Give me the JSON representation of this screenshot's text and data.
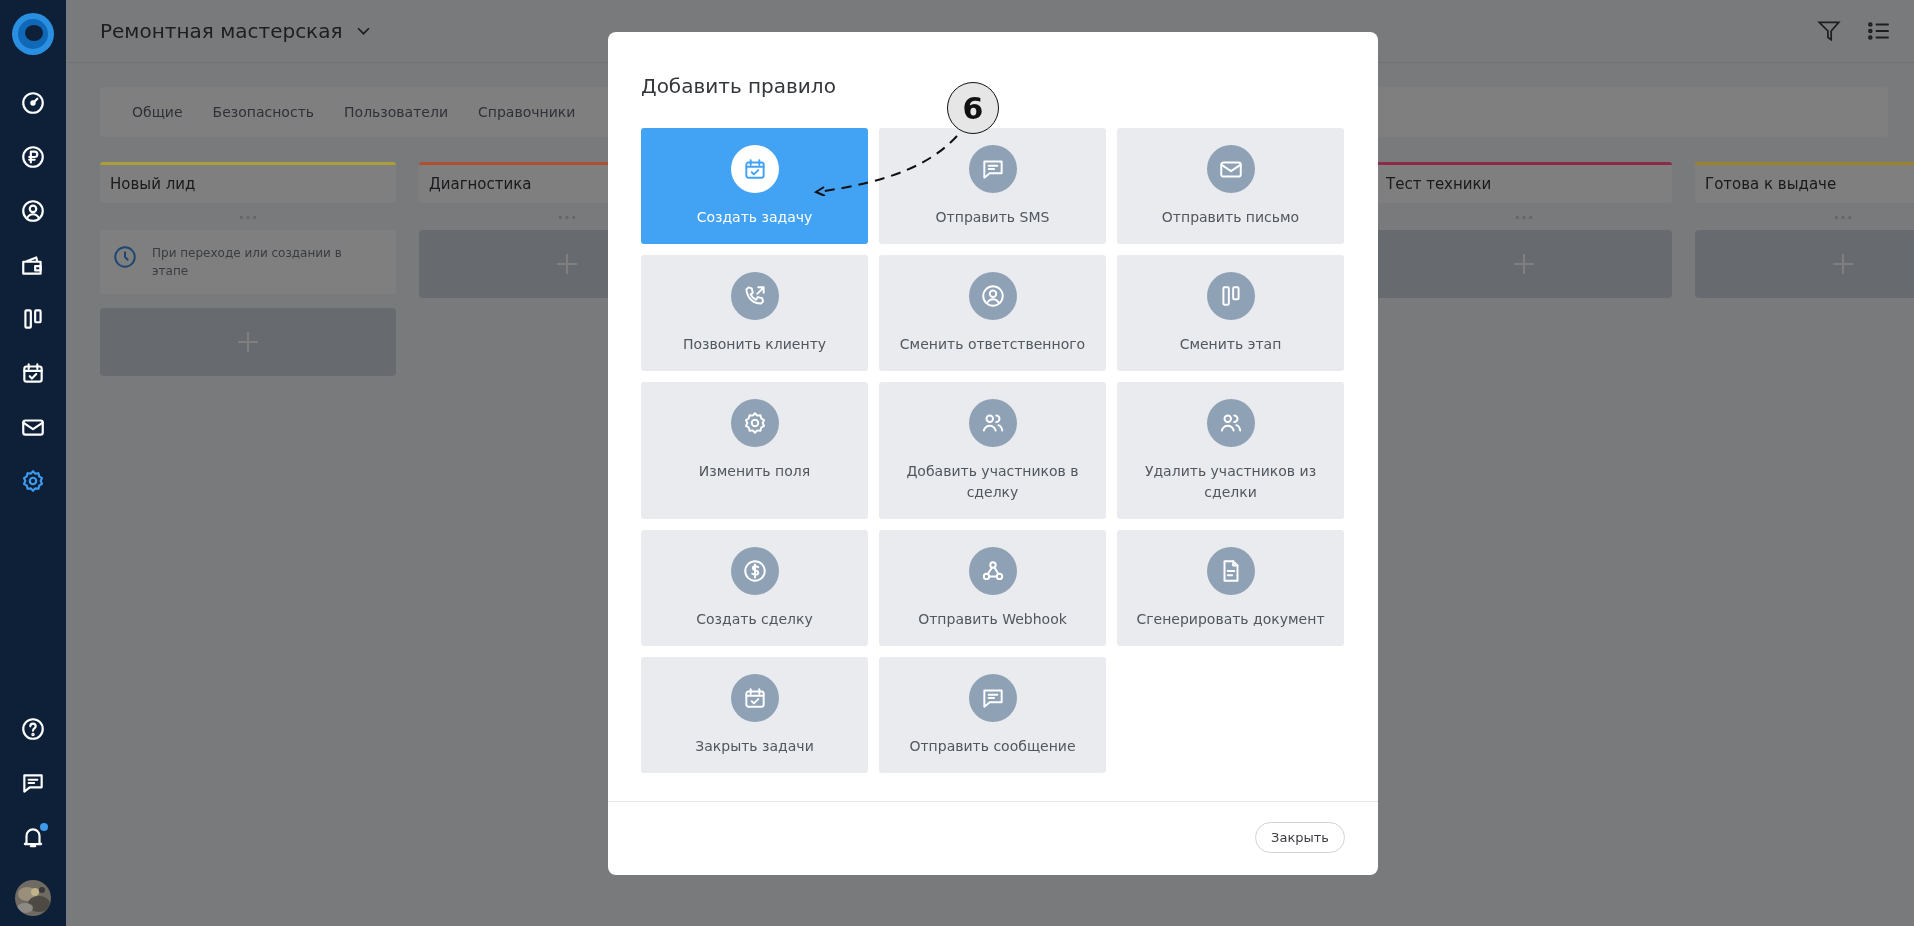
{
  "sidebar": {
    "top": [
      {
        "kind": "gauge",
        "selected": false
      },
      {
        "kind": "ruble",
        "selected": false
      },
      {
        "kind": "user",
        "selected": false
      },
      {
        "kind": "wallet",
        "selected": false
      },
      {
        "kind": "columns",
        "selected": false
      },
      {
        "kind": "calendar",
        "selected": false
      },
      {
        "kind": "mail",
        "selected": false
      },
      {
        "kind": "gear",
        "selected": true
      }
    ],
    "bottom": [
      {
        "kind": "help"
      },
      {
        "kind": "chat"
      },
      {
        "kind": "bell"
      },
      {
        "kind": "avatar"
      }
    ]
  },
  "header": {
    "title": "Ремонтная мастерская"
  },
  "tabs": [
    "Общие",
    "Безопасность",
    "Пользователи",
    "Справочники"
  ],
  "columns": [
    {
      "title": "Новый лид",
      "color": "#a9a03c",
      "cards": [
        {
          "kind": "rule",
          "text": "При переходе или создании в этапе"
        },
        {
          "kind": "add"
        }
      ]
    },
    {
      "title": "Диагностика",
      "color": "#b0502e",
      "cards": [
        {
          "kind": "add"
        }
      ]
    },
    {
      "title": "Тест техники",
      "color": "#8c2a48",
      "cards": [
        {
          "kind": "add"
        }
      ]
    },
    {
      "title": "Готова к выдаче",
      "color": "#9c8228",
      "cards": [
        {
          "kind": "add"
        }
      ]
    }
  ],
  "dialog": {
    "title": "Добавить правило",
    "tiles": [
      {
        "kind": "calendar",
        "label": "Создать задачу",
        "selected": true
      },
      {
        "kind": "chat",
        "label": "Отправить SMS",
        "selected": false
      },
      {
        "kind": "mail",
        "label": "Отправить письмо",
        "selected": false
      },
      {
        "kind": "phone",
        "label": "Позвонить клиенту",
        "selected": false
      },
      {
        "kind": "user",
        "label": "Сменить ответственного",
        "selected": false
      },
      {
        "kind": "columns",
        "label": "Сменить этап",
        "selected": false
      },
      {
        "kind": "gear",
        "label": "Изменить поля",
        "selected": false
      },
      {
        "kind": "users",
        "label": "Добавить участников в сделку",
        "selected": false
      },
      {
        "kind": "users",
        "label": "Удалить участников из сделки",
        "selected": false
      },
      {
        "kind": "dollar",
        "label": "Создать сделку",
        "selected": false
      },
      {
        "kind": "webhook",
        "label": "Отправить Webhook",
        "selected": false
      },
      {
        "kind": "document",
        "label": "Сгенерировать документ",
        "selected": false
      },
      {
        "kind": "calendar",
        "label": "Закрыть задачи",
        "selected": false
      },
      {
        "kind": "chat",
        "label": "Отправить сообщение",
        "selected": false
      }
    ],
    "close_button": "Закрыть"
  },
  "callout": {
    "label": "6"
  }
}
